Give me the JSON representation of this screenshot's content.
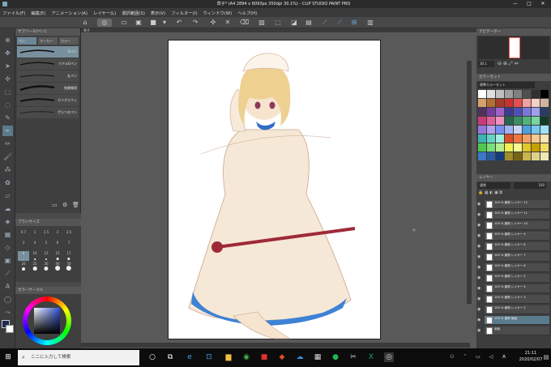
{
  "titlebar": {
    "title": "草子* (A4 2894 x 6093px 350dpi 30.1%) - CLIP STUDIO PAINT PRO",
    "min": "—",
    "max": "□",
    "close": "✕"
  },
  "menu": [
    "ファイル(F)",
    "編集(E)",
    "アニメーション(A)",
    "レイヤー(L)",
    "選択範囲(S)",
    "表示(V)",
    "フィルター(I)",
    "ウィンドウ(W)",
    "ヘルプ(H)"
  ],
  "subtool_panel": {
    "header": "サブツール[ペン]",
    "tabs": [
      "ペン",
      "マーカー",
      "カラー"
    ],
    "brushes": [
      {
        "label": "Gペン",
        "selected": true
      },
      {
        "label": "リアルGペン",
        "selected": false
      },
      {
        "label": "丸ペン",
        "selected": false
      },
      {
        "label": "効果線用",
        "selected": false
      },
      {
        "label": "カリグラフィ",
        "selected": false
      },
      {
        "label": "ざらつきペン",
        "selected": false
      }
    ]
  },
  "brushsize_panel": {
    "header": "ブラシサイズ",
    "sizes": [
      "0.7",
      "1",
      "1.5",
      "2",
      "2.5",
      "3",
      "4",
      "5",
      "6",
      "7",
      "8",
      "10",
      "12",
      "15",
      "17",
      "20",
      "25",
      "30",
      "40",
      "50"
    ],
    "selected_index": 10
  },
  "colorwheel_panel": {
    "header": "カラーサークル",
    "main_color": "#1e2a55",
    "sub_color": "#ffffff"
  },
  "canvas_tab": "草子",
  "navigator": {
    "header": "ナビゲーター",
    "zoom": "30.1"
  },
  "colorset": {
    "header": "カラーセット",
    "set_name": "標準カラーセット",
    "swatches": [
      "#ffffff",
      "#e0e0e0",
      "#c0c0c0",
      "#a0a0a0",
      "#808080",
      "#505050",
      "#303030",
      "#000000",
      "#d4a070",
      "#b46e32",
      "#a03c28",
      "#c83232",
      "#e05050",
      "#f0a0a0",
      "#f4d0c8",
      "#d4b4a0",
      "#50325a",
      "#783ca0",
      "#a060c8",
      "#3c3c8c",
      "#5050b4",
      "#7878dc",
      "#a0a0f0",
      "#283c64",
      "#c83c78",
      "#e0609c",
      "#f090c0",
      "#286450",
      "#3c8c64",
      "#50b478",
      "#78d4a0",
      "#143c28",
      "#9678dc",
      "#b4a0f0",
      "#7890f0",
      "#a0b4f4",
      "#c8d4f8",
      "#50a0dc",
      "#78c8f0",
      "#a0e0f8",
      "#3cb4b4",
      "#64d4c8",
      "#a0f0e0",
      "#dc5028",
      "#f07840",
      "#f4a060",
      "#f8c890",
      "#fce4b4",
      "#50c850",
      "#78e078",
      "#b4f08c",
      "#f0f050",
      "#f8f890",
      "#e0c828",
      "#c8a000",
      "#f4dc64",
      "#3c78c8",
      "#285aa0",
      "#143c78",
      "#a08c28",
      "#786414",
      "#c8b450",
      "#e0d08c",
      "#f0e8b4"
    ]
  },
  "layer_panel": {
    "header": "レイヤー",
    "blend_mode": "通常",
    "opacity": "100",
    "layers": [
      {
        "name": "100 % 通常 レイヤー 12",
        "selected": false
      },
      {
        "name": "100 % 通常 レイヤー 11",
        "selected": false
      },
      {
        "name": "100 % 通常 レイヤー 10",
        "selected": false
      },
      {
        "name": "100 % 通常 レイヤー 9",
        "selected": false
      },
      {
        "name": "100 % 通常 レイヤー 8",
        "selected": false
      },
      {
        "name": "100 % 通常 レイヤー 7",
        "selected": false
      },
      {
        "name": "100 % 通常 レイヤー 6",
        "selected": false
      },
      {
        "name": "100 % 通常 レイヤー 5",
        "selected": false
      },
      {
        "name": "100 % 通常 レイヤー 4",
        "selected": false
      },
      {
        "name": "100 % 通常 レイヤー 3",
        "selected": false
      },
      {
        "name": "100 % 通常 レイヤー 2",
        "selected": false
      },
      {
        "name": "100 % 通常 線画",
        "selected": true
      },
      {
        "name": "用紙",
        "selected": false
      }
    ]
  },
  "taskbar": {
    "search_placeholder": "ここに入力して検索",
    "time": "21:11",
    "date": "2020/02/07"
  }
}
